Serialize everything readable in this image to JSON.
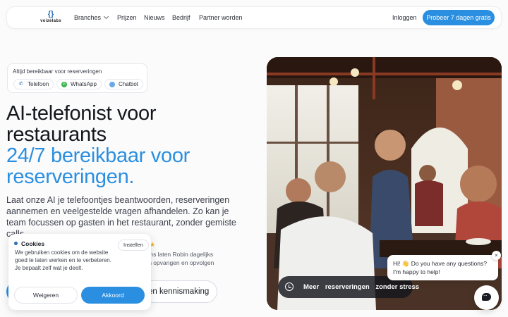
{
  "nav": {
    "logo_mark": "{}",
    "logo_text": "voizelabs",
    "branches": "Branches",
    "prijzen": "Prijzen",
    "nieuws": "Nieuws",
    "bedrijf": "Bedrijf",
    "partner": "Partner worden",
    "login": "Inloggen",
    "cta": "Probeer 7 dagen gratis"
  },
  "badge": {
    "title": "Altijd bereikbaar voor reserveringen",
    "chips": [
      {
        "label": "Telefoon",
        "icon": "phone-icon"
      },
      {
        "label": "WhatsApp",
        "icon": "whatsapp-icon"
      },
      {
        "label": "Chatbot",
        "icon": "chatbot-icon"
      }
    ]
  },
  "hero": {
    "title_line1": "AI-telefonist voor",
    "title_line2": "restaurants",
    "accent_line1": "24/7 bereikbaar voor",
    "accent_line2": "reserveringen.",
    "lead": "Laat onze AI je telefoontjes beantwoorden, reserveringen aannemen en veelgestelde vragen afhandelen. Zo kan je team focussen op gasten in het restaurant, zonder gemiste calls.",
    "proof_line1": "AI 50+ teams laten Robin dagelijks",
    "proof_line2": "gesprekken opvangen en opvolgen",
    "demo_button": "en kennismaking",
    "image_pill": [
      "Meer",
      "reserveringen",
      "zonder stress"
    ]
  },
  "cookie": {
    "title": "Cookies",
    "text": "We gebruiken cookies om de website goed te laten werken en te verbeteren. Je bepaalt zelf wat je deelt.",
    "settings": "Instellen",
    "reject": "Weigeren",
    "accept": "Akkoord"
  },
  "chat": {
    "message": "Hi! 👋 Do you have any questions? I'm happy to help!",
    "close": "×"
  },
  "colors": {
    "accent": "#2a8fe0",
    "headline": "#14171d",
    "star": "#f2b01e"
  }
}
